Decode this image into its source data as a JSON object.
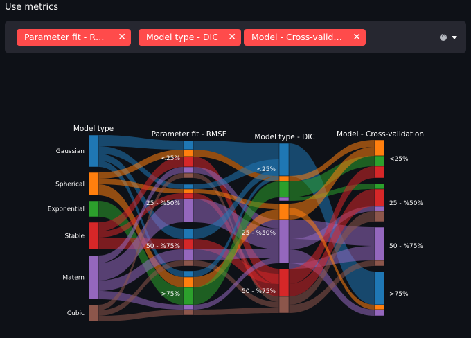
{
  "title": "Use metrics",
  "multiselect": {
    "chips": [
      {
        "label": "Parameter fit - RMSE"
      },
      {
        "label": "Model type - DIC"
      },
      {
        "label": "Model - Cross-validation"
      }
    ],
    "chip_display": [
      "Parameter fit - RMSE",
      "Model type - DIC",
      "Model - Cross-valid…"
    ],
    "icons": {
      "remove": "close-icon",
      "clear": "clear-icon",
      "expand": "chevron-down-icon"
    }
  },
  "chart_data": {
    "type": "sankey",
    "columns": [
      {
        "title": "Model type",
        "nodes": [
          "Gaussian",
          "Spherical",
          "Exponential",
          "Stable",
          "Matern",
          "Cubic"
        ]
      },
      {
        "title": "Parameter fit - RMSE",
        "nodes": [
          "<25%",
          "25 - %50%",
          "50 - %75%",
          ">75%"
        ]
      },
      {
        "title": "Model type - DIC",
        "nodes": [
          "<25%",
          "25 - %50%",
          "50 - %75%"
        ]
      },
      {
        "title": "Model - Cross-validation",
        "nodes": [
          "<25%",
          "25 - %50%",
          "50 - %75%",
          ">75%"
        ]
      }
    ],
    "colors": {
      "Gaussian": "#1f77b4",
      "Spherical": "#ff7f0e",
      "Exponential": "#2ca02c",
      "Stable": "#d62728",
      "Matern": "#9467bd",
      "Cubic": "#8c564b"
    }
  }
}
